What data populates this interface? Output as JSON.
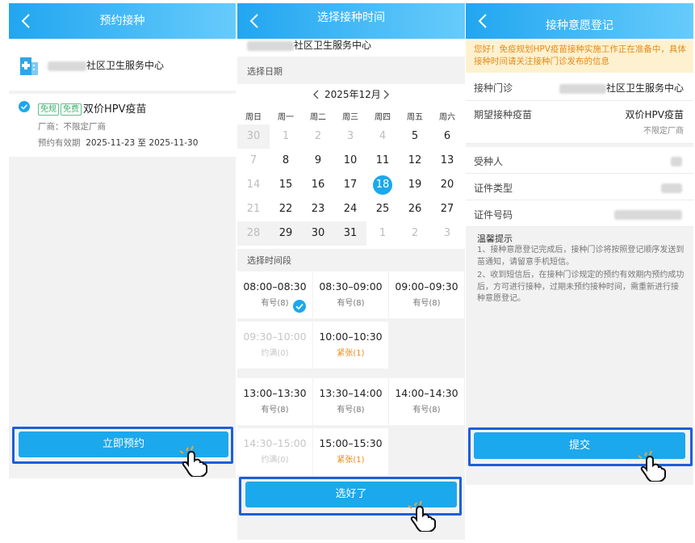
{
  "panel1": {
    "title": "预约接种",
    "center_name": "社区卫生服务中心",
    "tags": [
      "免规",
      "免费"
    ],
    "vaccine": "双价HPV疫苗",
    "manufacturer": "厂商：不限定厂商",
    "validity_label": "预约有效期",
    "validity_value": "2025-11-23 至 2025-11-30",
    "button": "立即预约"
  },
  "panel2": {
    "title": "选择接种时间",
    "center_name": "社区卫生服务中心",
    "date_section": "选择日期",
    "month": "2025年12月",
    "weekdays": [
      "周日",
      "周一",
      "周二",
      "周三",
      "周四",
      "周五",
      "周六"
    ],
    "weeks": [
      [
        "30",
        "1",
        "2",
        "3",
        "4",
        "5",
        "6"
      ],
      [
        "7",
        "8",
        "9",
        "10",
        "11",
        "12",
        "13"
      ],
      [
        "14",
        "15",
        "16",
        "17",
        "18",
        "19",
        "20"
      ],
      [
        "21",
        "22",
        "23",
        "24",
        "25",
        "26",
        "27"
      ],
      [
        "28",
        "29",
        "30",
        "31",
        "1",
        "2",
        "3"
      ]
    ],
    "selected_day": "18",
    "time_section": "选择时间段",
    "slots": [
      {
        "time": "08:00–08:30",
        "status": "有号(8)"
      },
      {
        "time": "08:30–09:00",
        "status": "有号(8)"
      },
      {
        "time": "09:00–09:30",
        "status": "有号(8)"
      },
      {
        "time": "09:30–10:00",
        "status": "约满(0)"
      },
      {
        "time": "10:00–10:30",
        "status": "紧张(1)"
      },
      {
        "time": "13:00–13:30",
        "status": "有号(8)"
      },
      {
        "time": "13:30–14:00",
        "status": "有号(8)"
      },
      {
        "time": "14:00–14:30",
        "status": "有号(8)"
      },
      {
        "time": "14:30–15:00",
        "status": "约满(0)"
      },
      {
        "time": "15:00–15:30",
        "status": "紧张(1)"
      }
    ],
    "button": "选好了"
  },
  "panel3": {
    "title": "接种意愿登记",
    "notice": "您好！免疫规划HPV疫苗接种实施工作正在准备中，具体接种时间请关注接种门诊发布的信息",
    "clinic_label": "接种门诊",
    "clinic_value": "社区卫生服务中心",
    "vaccine_label": "期望接种疫苗",
    "vaccine_value": "双价HPV疫苗",
    "vaccine_sub": "不限定厂商",
    "recipient_label": "受种人",
    "id_type_label": "证件类型",
    "id_no_label": "证件号码",
    "tips_title": "温馨提示",
    "tip1": "1、接种意愿登记完成后，接种门诊将按照登记顺序发送到苗通知，请留意手机短信。",
    "tip2": "2、收到短信后，在接种门诊规定的预约有效期内预约成功后，方可进行接种，过期未预约接种时间，需重新进行接种意愿登记。",
    "button": "提交"
  },
  "colors": {
    "accent": "#1ca8ec",
    "highlight": "#1d5fd8",
    "warning": "#f08a1c",
    "tag": "#3fae6e"
  }
}
